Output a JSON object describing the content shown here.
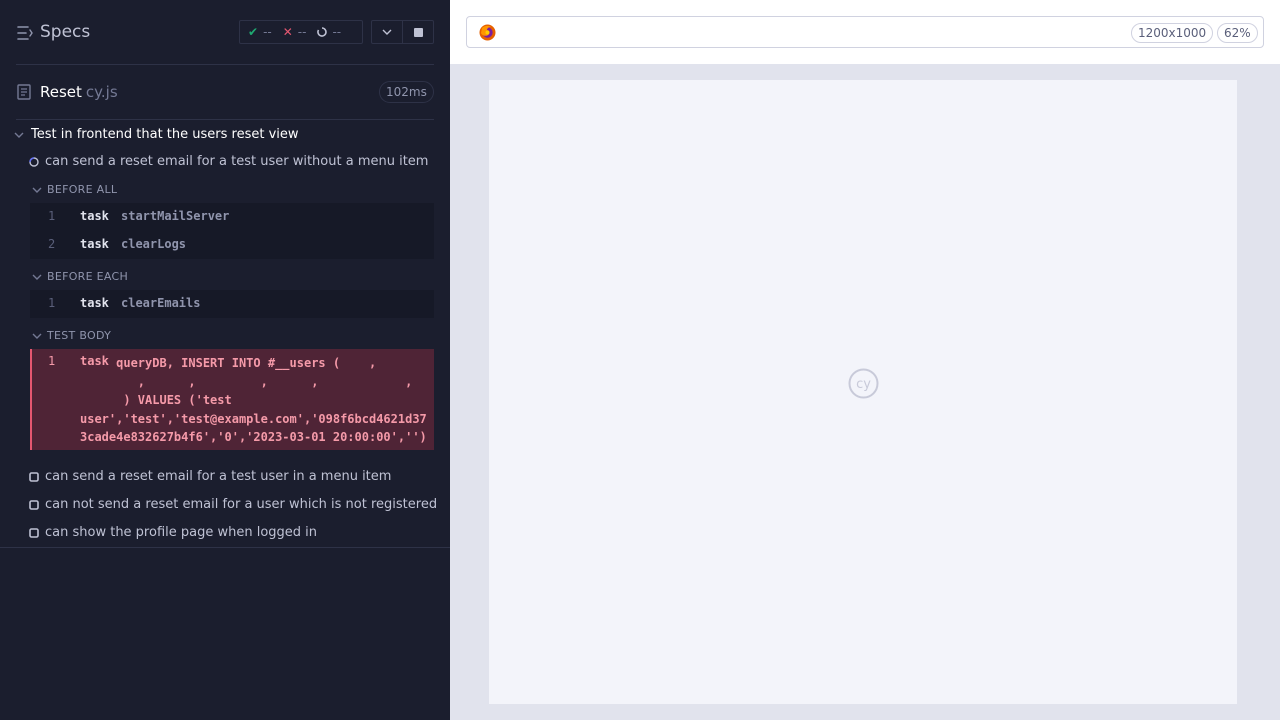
{
  "header": {
    "specs_label": "Specs",
    "stats": {
      "passed": "--",
      "failed": "--",
      "pending": "--"
    }
  },
  "spec": {
    "name": "Reset",
    "ext": "cy.js",
    "duration": "102ms"
  },
  "suite": {
    "title": "Test in frontend that the users reset view"
  },
  "tests": [
    {
      "label": "can send a reset email for a test user without a menu item",
      "state": "running"
    },
    {
      "label": "can send a reset email for a test user in a menu item",
      "state": "pending"
    },
    {
      "label": "can not send a reset email for a user which is not registered",
      "state": "pending"
    },
    {
      "label": "can show the profile page when logged in",
      "state": "pending"
    }
  ],
  "hooks": {
    "before_all": {
      "label": "BEFORE ALL",
      "commands": [
        {
          "num": "1",
          "name": "task",
          "arg": "startMailServer"
        },
        {
          "num": "2",
          "name": "task",
          "arg": "clearLogs"
        }
      ]
    },
    "before_each": {
      "label": "BEFORE EACH",
      "commands": [
        {
          "num": "1",
          "name": "task",
          "arg": "clearEmails"
        }
      ]
    },
    "test_body": {
      "label": "TEST BODY",
      "command": {
        "num": "1",
        "name": "task",
        "text": "     queryDB, INSERT INTO #__users (    ,\n        ,      ,         ,      ,            ,\n      ) VALUES ('test\nuser','test','test@example.com','098f6bcd4621d37\n3cade4e832627b4f6','0','2023-03-01 20:00:00','')"
      }
    }
  },
  "aut": {
    "viewport": "1200x1000",
    "zoom": "62%",
    "browser_icon": "firefox-icon",
    "logo": "cy"
  },
  "colors": {
    "panel_bg": "#1b1e2e",
    "pass": "#1fa971",
    "fail": "#e45770",
    "failed_bg": "#4f2436",
    "aut_bg": "#e1e3ed",
    "frame_bg": "#f3f4fa"
  }
}
